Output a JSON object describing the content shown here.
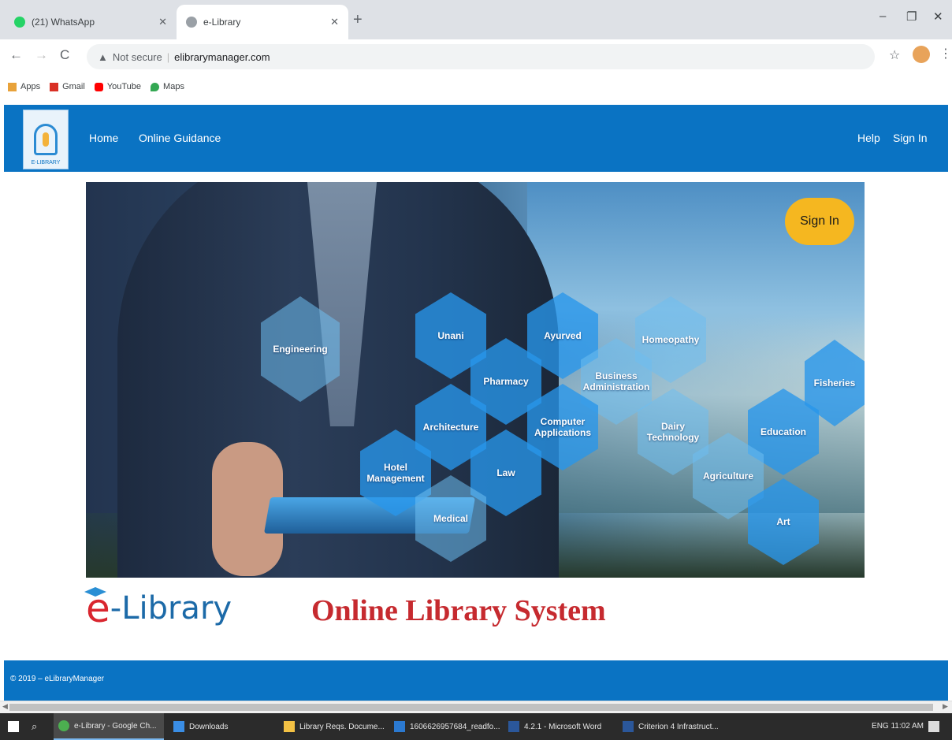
{
  "browser": {
    "tabs": [
      {
        "title": "(21) WhatsApp",
        "active": false,
        "favicon_color": "#25d366"
      },
      {
        "title": "e-Library",
        "active": true,
        "favicon_color": "#5f6368"
      }
    ],
    "new_tab_symbol": "+",
    "window_controls": {
      "minimize": "–",
      "restore": "❐",
      "close": "✕"
    },
    "nav": {
      "back": "←",
      "forward": "→",
      "reload": "C"
    },
    "address": {
      "security_label": "Not secure",
      "url": "elibrarymanager.com"
    },
    "bookmarks": [
      {
        "label": "Apps",
        "icon": "apps-grid-icon",
        "color": "#e8a23a"
      },
      {
        "label": "Gmail",
        "icon": "gmail-icon",
        "color": "#d93025"
      },
      {
        "label": "YouTube",
        "icon": "youtube-icon",
        "color": "#ff0000"
      },
      {
        "label": "Maps",
        "icon": "maps-pin-icon",
        "color": "#34a853"
      }
    ]
  },
  "site": {
    "logo_label": "E-LIBRARY",
    "nav_left": [
      "Home",
      "Online Guidance"
    ],
    "nav_right": [
      "Help",
      "Sign In"
    ],
    "hero_signin": "Sign In",
    "categories": [
      "Engineering",
      "Unani",
      "Ayurved",
      "Homeopathy",
      "Pharmacy",
      "Business Administration",
      "Fisheries",
      "Architecture",
      "Computer Applications",
      "Dairy Technology",
      "Education",
      "Hotel Management",
      "Law",
      "Agriculture",
      "Medical",
      "Art"
    ],
    "brand_e": "e",
    "brand_rest": "-Library",
    "tagline": "Online Library System",
    "footer": "© 2019 – eLibraryManager",
    "accent_color": "#0a73c3",
    "tagline_color": "#c62a2f"
  },
  "taskbar": {
    "items": [
      {
        "label": "e-Library - Google Ch...",
        "active": true
      },
      {
        "label": "Downloads",
        "active": false
      },
      {
        "label": "Library Reqs. Docume...",
        "active": false
      },
      {
        "label": "1606626957684_readfo...",
        "active": false
      },
      {
        "label": "4.2.1 - Microsoft Word",
        "active": false
      },
      {
        "label": "Criterion 4 Infrastruct...",
        "active": false
      }
    ],
    "tray": "ENG  11:02 AM"
  }
}
